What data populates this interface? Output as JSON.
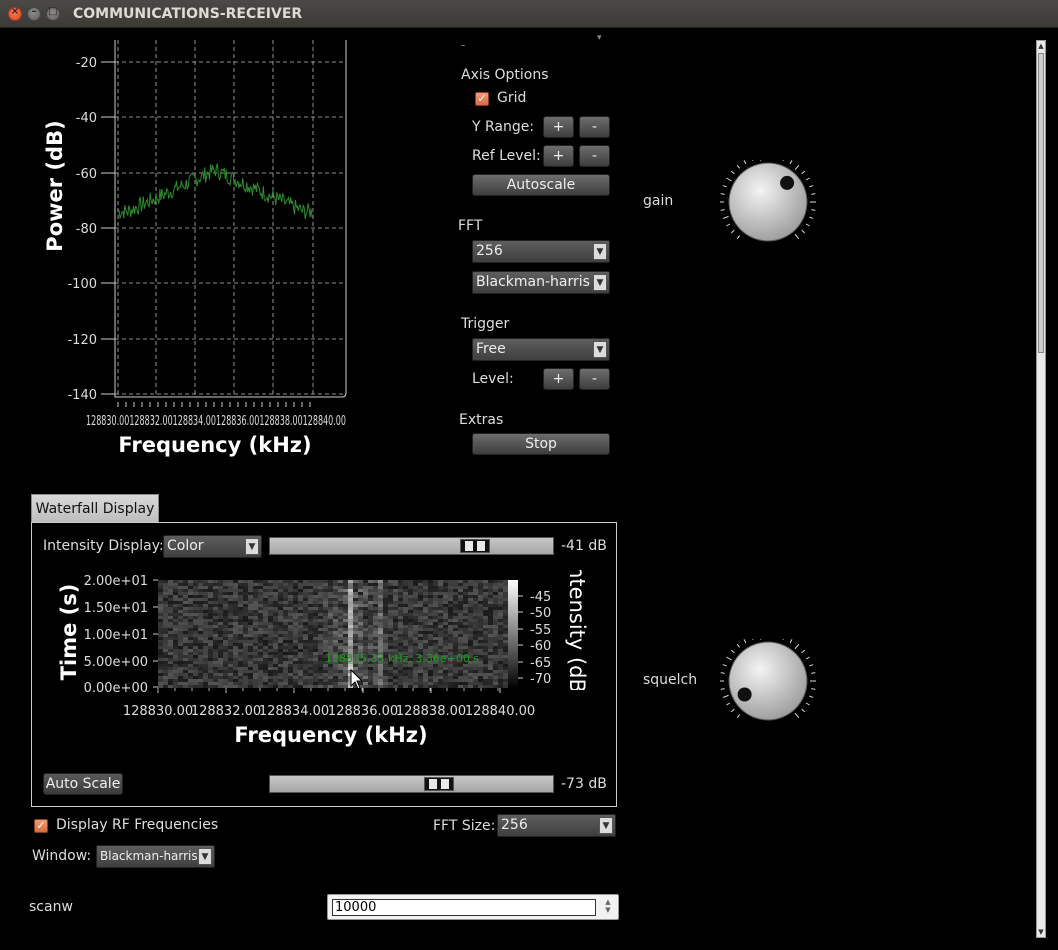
{
  "window": {
    "title": "COMMUNICATIONS-RECEIVER"
  },
  "spectrum": {
    "ylabel": "Power (dB)",
    "xlabel": "Frequency (kHz)",
    "y_ticks": [
      "-20",
      "-40",
      "-60",
      "-80",
      "-100",
      "-120",
      "-140"
    ],
    "x_ticks_label": "128830.00128832.00128834.00128836.00128838.00128840.00",
    "x_tick_first": "128830",
    "x_tick_last": "840.00",
    "trace_color": "#2e8b2e"
  },
  "axis_options": {
    "title": "Axis Options",
    "grid_label": "Grid",
    "grid_checked": true,
    "y_range_label": "Y Range:",
    "ref_level_label": "Ref Level:",
    "plus": "+",
    "minus": "-",
    "autoscale": "Autoscale"
  },
  "fft": {
    "title": "FFT",
    "size": "256",
    "window": "Blackman-harris"
  },
  "trigger": {
    "title": "Trigger",
    "mode": "Free",
    "level_label": "Level:"
  },
  "extras": {
    "title": "Extras",
    "stop": "Stop"
  },
  "knobs": {
    "gain_label": "gain",
    "squelch_label": "squelch"
  },
  "waterfall": {
    "tab": "Waterfall Display",
    "intensity_label": "Intensity Display:",
    "intensity_mode": "Color",
    "max_db": "-41 dB",
    "min_db": "-73 dB",
    "auto_scale": "Auto Scale",
    "ylabel": "Time (s)",
    "xlabel": "Frequency (kHz)",
    "colorbar_label": "Intensity (dB)",
    "y_ticks": [
      "2.00e+01",
      "1.50e+01",
      "1.00e+01",
      "5.00e+00",
      "0.00e+00"
    ],
    "x_ticks": [
      "128830.00",
      "128832.00",
      "128834.00",
      "128836.00",
      "128838.00",
      "128840.00"
    ],
    "cb_ticks": [
      "-45",
      "-50",
      "-55",
      "-60",
      "-65",
      "-70"
    ],
    "cursor_readout": "128835.33 kHz, 3.36e+00 s",
    "max_slider_fraction": 0.75,
    "min_slider_fraction": 0.61
  },
  "bottom": {
    "display_rf_label": "Display RF Frequencies",
    "display_rf_checked": true,
    "fft_size_label": "FFT Size:",
    "fft_size_value": "256",
    "window_label": "Window:",
    "window_value": "Blackman-harris",
    "scanw_label": "scanw",
    "scanw_value": "10000"
  }
}
